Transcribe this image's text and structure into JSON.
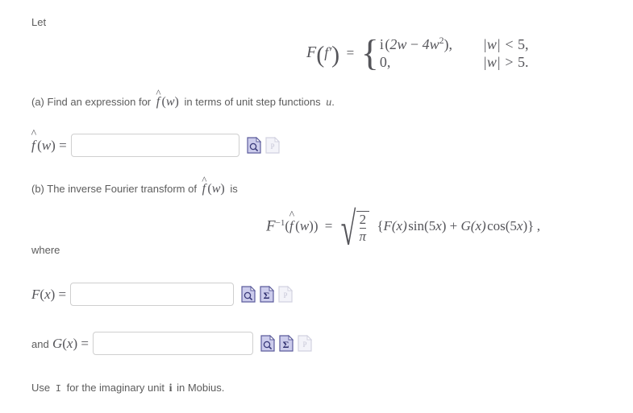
{
  "problem": {
    "intro": "Let",
    "given": {
      "lhs_operator": "F",
      "lhs_arg": "f′",
      "equals": "=",
      "cases": [
        {
          "value": "i(2w − 4w²),",
          "condition": "|w| < 5,"
        },
        {
          "value": "0,",
          "condition": "|w| > 5."
        }
      ]
    },
    "part_a": {
      "text_before": "(a) Find an expression for",
      "fn": "f̂(w)",
      "text_after": "in terms of unit step functions",
      "symbol": "u",
      "period": "."
    },
    "answer_a": {
      "label_fn": "f̂(w)",
      "label_equals": "=",
      "value": "",
      "placeholder": ""
    },
    "part_b": {
      "text_before": "(b) The inverse Fourier transform of",
      "fn": "f̂(w)",
      "text_after": "is"
    },
    "inverse_eq": {
      "operator": "F",
      "exponent": "−1",
      "arg": "(f̂(w))",
      "equals": "=",
      "radical_num": "2",
      "radical_den": "π",
      "body": "{F(x) sin(5x) + G(x) cos(5x)} ,",
      "body_parts": {
        "open_brace": "{",
        "F": "F(x)",
        "sin": "sin(5x)",
        "plus": "+",
        "G": "G(x)",
        "cos": "cos(5x)",
        "close_brace": "}",
        "comma": ","
      }
    },
    "where_text": "where",
    "answer_F": {
      "label_fn": "F(x)",
      "label_equals": "=",
      "value": "",
      "placeholder": ""
    },
    "answer_G": {
      "label_prefix": "and",
      "label_fn": "G(x)",
      "label_equals": "=",
      "value": "",
      "placeholder": ""
    },
    "footnote": {
      "before": "Use",
      "code": "I",
      "middle": "for the imaginary unit",
      "italic_i": "i",
      "after": "in Mobius."
    }
  },
  "icons": {
    "preview": "preview-document-icon",
    "sigma": "sigma-document-icon",
    "help": "help-document-icon"
  },
  "colors": {
    "text": "#5c5c5c",
    "math": "#55555a",
    "icon_fill": "#ccccec",
    "icon_stroke": "#5c5c9c",
    "input_border": "#cfcfcf",
    "background": "#ffffff"
  }
}
